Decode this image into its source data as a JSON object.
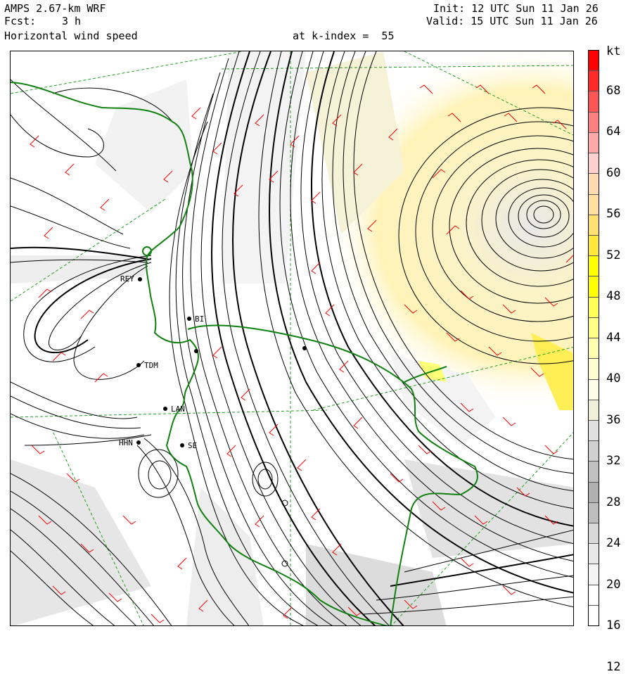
{
  "header": {
    "model": "AMPS 2.67-km WRF",
    "fcst_label": "Fcst:",
    "fcst_value": "3 h",
    "field": "Horizontal wind speed",
    "level": "at k-index =  55",
    "init": "Init: 12 UTC Sun 11 Jan 26",
    "valid": "Valid: 15 UTC Sun 11 Jan 26"
  },
  "colorbar": {
    "unit": "kt",
    "labels": [
      "68",
      "64",
      "60",
      "56",
      "52",
      "48",
      "44",
      "40",
      "36",
      "32",
      "28",
      "24",
      "20",
      "16",
      "12"
    ],
    "colors": [
      "#ff0000",
      "#ff2a2a",
      "#ff5555",
      "#ff8080",
      "#ffaaaa",
      "#ffd0d0",
      "#ffdcb0",
      "#ffe0a0",
      "#ffe070",
      "#ffe838",
      "#ffff00",
      "#ffff00",
      "#ffff55",
      "#ffff88",
      "#ffffb0",
      "#ffffd0",
      "#ffffe8",
      "#f0f0d8",
      "#e0e0e0",
      "#d0d0d0",
      "#c0c0c0",
      "#b0b0b0",
      "#bebebe",
      "#d8d8d8",
      "#e8e8e8",
      "#f4f4f4",
      "#ffffff",
      "#ffffff"
    ]
  },
  "stations": [
    "REY",
    "TDM",
    "LAN",
    "HHN",
    "SE",
    "BI"
  ],
  "colors": {
    "coast": "#108010",
    "barb": "#ff0000",
    "grid": "#20a020",
    "streamline": "#000000"
  }
}
